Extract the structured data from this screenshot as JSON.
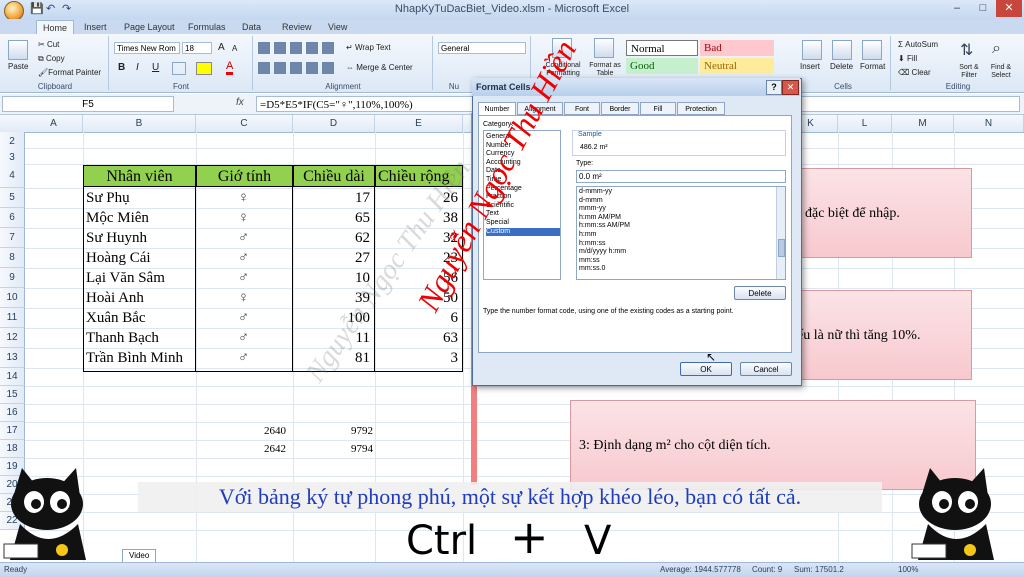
{
  "window": {
    "title": "NhapKyTuDacBiet_Video.xlsm - Microsoft Excel",
    "minimize": "–",
    "maximize": "□",
    "close": "✕"
  },
  "tabs": [
    "Home",
    "Insert",
    "Page Layout",
    "Formulas",
    "Data",
    "Review",
    "View"
  ],
  "ribbon": {
    "clipboard": {
      "paste": "Paste",
      "cut": "Cut",
      "copy": "Copy",
      "format_painter": "Format Painter",
      "label": "Clipboard"
    },
    "font": {
      "name": "Times New Rom",
      "size": "18",
      "label": "Font",
      "bold": "B",
      "italic": "I",
      "underline": "U",
      "grow": "A",
      "shrink": "A"
    },
    "alignment": {
      "wrap": "Wrap Text",
      "merge": "Merge & Center",
      "label": "Alignment"
    },
    "number": {
      "format": "General",
      "label": "Nu"
    },
    "styles": {
      "conditional": "Conditional Formatting",
      "format_table": "Format as Table",
      "normal": "Normal",
      "bad": "Bad",
      "good": "Good",
      "neutral": "Neutral"
    },
    "cells": {
      "insert": "Insert",
      "delete": "Delete",
      "format": "Format",
      "label": "Cells"
    },
    "editing": {
      "autosum": "AutoSum",
      "fill": "Fill",
      "clear": "Clear",
      "sort": "Sort & Filter",
      "find": "Find & Select",
      "label": "Editing"
    }
  },
  "formula_bar": {
    "name_box": "F5",
    "fx": "fx",
    "formula": "=D5*E5*IF(C5=\"♀\",110%,100%)"
  },
  "columns": [
    "A",
    "B",
    "C",
    "D",
    "E",
    "K",
    "L",
    "M",
    "N"
  ],
  "rows": [
    "2",
    "3",
    "4",
    "5",
    "6",
    "7",
    "8",
    "9",
    "10",
    "11",
    "12",
    "13",
    "14",
    "15",
    "16",
    "17",
    "18",
    "19",
    "20",
    "21",
    "22"
  ],
  "table": {
    "headers": [
      "Nhân viên",
      "Giớ tính",
      "Chiều dài",
      "Chiều rộng"
    ],
    "rows": [
      [
        "Sư Phụ",
        "♀",
        "17",
        "26"
      ],
      [
        "Mộc Miên",
        "♀",
        "65",
        "38"
      ],
      [
        "Sư Huynh",
        "♂",
        "62",
        "32"
      ],
      [
        "Hoàng Cái",
        "♂",
        "27",
        "23"
      ],
      [
        "Lại Văn Sâm",
        "♂",
        "10",
        "56"
      ],
      [
        "Hoài Anh",
        "♀",
        "39",
        "50"
      ],
      [
        "Xuân Bắc",
        "♂",
        "100",
        "6"
      ],
      [
        "Thanh Bạch",
        "♂",
        "11",
        "63"
      ],
      [
        "Trần Bình Minh",
        "♂",
        "81",
        "3"
      ]
    ],
    "extra": [
      [
        "2640",
        "9792"
      ],
      [
        "2642",
        "9794"
      ]
    ]
  },
  "notes": [
    "đặc biệt để nhập.",
    "ếu là nữ thì tăng 10%.",
    "3: Định dạng m² cho cột diện tích."
  ],
  "dialog": {
    "title": "Format Cells",
    "help": "?",
    "close": "✕",
    "tabs": [
      "Number",
      "Alignment",
      "Font",
      "Border",
      "Fill",
      "Protection"
    ],
    "category_label": "Category:",
    "categories": [
      "General",
      "Number",
      "Currency",
      "Accounting",
      "Date",
      "Time",
      "Percentage",
      "Fraction",
      "Scientific",
      "Text",
      "Special",
      "Custom"
    ],
    "selected_category": "Custom",
    "sample_label": "Sample",
    "sample_value": "486.2 m²",
    "type_label": "Type:",
    "type_value": "0.0 m²",
    "types": [
      "d-mmm-yy",
      "d-mmm",
      "mmm-yy",
      "h:mm AM/PM",
      "h:mm:ss AM/PM",
      "h:mm",
      "h:mm:ss",
      "m/d/yyyy h:mm",
      "mm:ss",
      "mm:ss.0"
    ],
    "delete": "Delete",
    "description": "Type the number format code, using one of the existing codes as a starting point.",
    "ok": "OK",
    "cancel": "Cancel"
  },
  "watermark": {
    "red": "Nguyễn Ngọc Thu Hiền",
    "gray": "Nguyễn Ngọc Thu Hiền"
  },
  "subtitle": "Với bảng ký tự phong phú, một sự kết hợp khéo léo, bạn có tất cả.",
  "keys": {
    "ctrl": "Ctrl",
    "plus": "+",
    "v": "V"
  },
  "sheet_tab": "Video",
  "status": {
    "ready": "Ready",
    "average": "Average: 1944.577778",
    "count": "Count: 9",
    "sum": "Sum: 17501.2",
    "zoom": "100%"
  }
}
